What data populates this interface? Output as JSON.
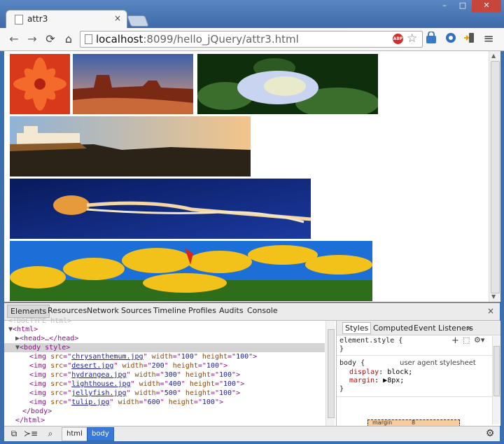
{
  "window": {
    "tab_title": "attr3",
    "tab_close": "×",
    "minimize": "–",
    "maximize": "□",
    "close": "✕"
  },
  "toolbar": {
    "url_host": "localhost",
    "url_rest": ":8099/hello_jQuery/attr3.html",
    "back_icon": "←",
    "forward_icon": "→",
    "reload_icon": "⟳",
    "home_icon": "⌂",
    "abp_label": "ABP",
    "star_icon": "☆",
    "menu_icon": "≡",
    "ext_icons": [
      "lock-icon",
      "puzzle-icon",
      "phone-icon"
    ]
  },
  "images": [
    {
      "name": "chrysanthemum",
      "colors": [
        "#d8391a",
        "#f36a2a",
        "#b32012"
      ]
    },
    {
      "name": "desert",
      "colors": [
        "#3d5fa8",
        "#c9693a",
        "#7a2a14"
      ]
    },
    {
      "name": "hydrangea",
      "colors": [
        "#0e2e0c",
        "#c9d4f0",
        "#3b6d2c"
      ]
    },
    {
      "name": "lighthouse",
      "colors": [
        "#8fb3d6",
        "#f3c48a",
        "#2b2218"
      ]
    },
    {
      "name": "jellyfish",
      "colors": [
        "#091a5c",
        "#1b3aa0",
        "#e79a3c"
      ]
    },
    {
      "name": "tulip",
      "colors": [
        "#1b6fd6",
        "#f2c21a",
        "#2e6d1a"
      ]
    }
  ],
  "devtools": {
    "tabs": [
      "Elements",
      "Resources",
      "Network",
      "Sources",
      "Timeline",
      "Profiles",
      "Audits",
      "Console"
    ],
    "active_tab": "Elements",
    "close": "×",
    "dom": {
      "faded": "<!DOCTYPE html>",
      "html_open": "<html>",
      "head": "<head>…</head>",
      "body_open": "<body style>",
      "imgs": [
        {
          "src": "chrysanthemum.jpg",
          "width": "100",
          "height": "100"
        },
        {
          "src": "desert.jpg",
          "width": "200",
          "height": "100"
        },
        {
          "src": "hydrangea.jpg",
          "width": "300",
          "height": "100"
        },
        {
          "src": "lighthouse.jpg",
          "width": "400",
          "height": "100"
        },
        {
          "src": "jellyfish.jpg",
          "width": "500",
          "height": "100"
        },
        {
          "src": "tulip.jpg",
          "width": "600",
          "height": "100"
        }
      ],
      "body_close": "</body>",
      "html_close": "</html>"
    },
    "styles": {
      "tabs": [
        "Styles",
        "Computed",
        "Event Listeners"
      ],
      "more": "»",
      "element_style": "element.style {",
      "close_brace": "}",
      "body_rule": "body {",
      "origin": "user agent stylesheet",
      "decl1_prop": "display",
      "decl1_val": "block;",
      "decl2_prop": "margin",
      "decl2_val": "▶8px;",
      "margin_label": "margin",
      "margin_val": "8"
    },
    "breadcrumbs": [
      "html",
      "body"
    ],
    "active_crumb": "body"
  }
}
